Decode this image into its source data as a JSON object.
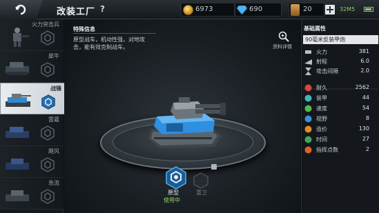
{
  "header": {
    "title": "改装工厂",
    "help_label": "?",
    "gold": "6973",
    "gems": "690",
    "fuel": "20",
    "time": "32M5",
    "back_icon": "back-arrow-icon"
  },
  "sidebar": {
    "items": [
      {
        "label": "火力突击兵",
        "active": false
      },
      {
        "label": "犀牛",
        "active": false
      },
      {
        "label": "战锤",
        "active": true
      },
      {
        "label": "雷霆",
        "active": false
      },
      {
        "label": "飓风",
        "active": false
      },
      {
        "label": "急流",
        "active": false
      }
    ]
  },
  "feature": {
    "title": "特殊信息",
    "description": "原型战车，机动性强，对地攻击，能有效克制战车。"
  },
  "zoom_label": "资料详情",
  "modes": [
    {
      "label": "原型",
      "status": "使用中"
    },
    {
      "label": "重卫",
      "status": ""
    }
  ],
  "panel": {
    "heading": "基础属性",
    "weapon": "90毫米反装甲炮",
    "weapon_stats": [
      {
        "key": "火力",
        "value": "381",
        "icon": "firepower-icon"
      },
      {
        "key": "射程",
        "value": "6.0",
        "icon": "range-icon"
      },
      {
        "key": "攻击间隔",
        "value": "2.0",
        "icon": "hourglass-icon"
      }
    ],
    "unit_stats": [
      {
        "key": "耐久",
        "value": "2562",
        "icon": "heart-icon",
        "color": "#d8463e"
      },
      {
        "key": "装甲",
        "value": "44",
        "icon": "armor-icon",
        "color": "#3fb6b6"
      },
      {
        "key": "速度",
        "value": "54",
        "icon": "speed-icon",
        "color": "#54b84a"
      },
      {
        "key": "视野",
        "value": "8",
        "icon": "eye-icon",
        "color": "#3b8fd6"
      },
      {
        "key": "造价",
        "value": "130",
        "icon": "cost-icon",
        "color": "#e38a2a"
      },
      {
        "key": "时间",
        "value": "27",
        "icon": "clock-icon",
        "color": "#3fa65a"
      },
      {
        "key": "指挥点数",
        "value": "2",
        "icon": "command-icon",
        "color": "#d8632a"
      }
    ]
  }
}
